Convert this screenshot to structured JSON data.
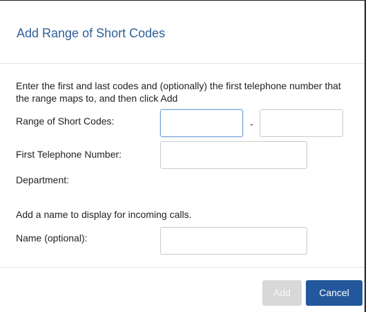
{
  "dialog": {
    "title": "Add Range of Short Codes",
    "instructions": "Enter the first and last codes and (optionally) the first telephone number that the range maps to, and then click Add",
    "range_label": "Range of Short Codes:",
    "range_separator": "-",
    "range_start_value": "",
    "range_end_value": "",
    "first_number_label": "First Telephone Number:",
    "first_number_value": "",
    "department_label": "Department:",
    "name_hint": "Add a name to display for incoming calls.",
    "name_label": "Name (optional):",
    "name_value": "",
    "add_label": "Add",
    "cancel_label": "Cancel",
    "colors": {
      "title": "#2f5f9a",
      "cancel_button": "#23589c",
      "add_button_disabled": "#d8d8d8",
      "focus_border": "#6fa3d6"
    }
  }
}
